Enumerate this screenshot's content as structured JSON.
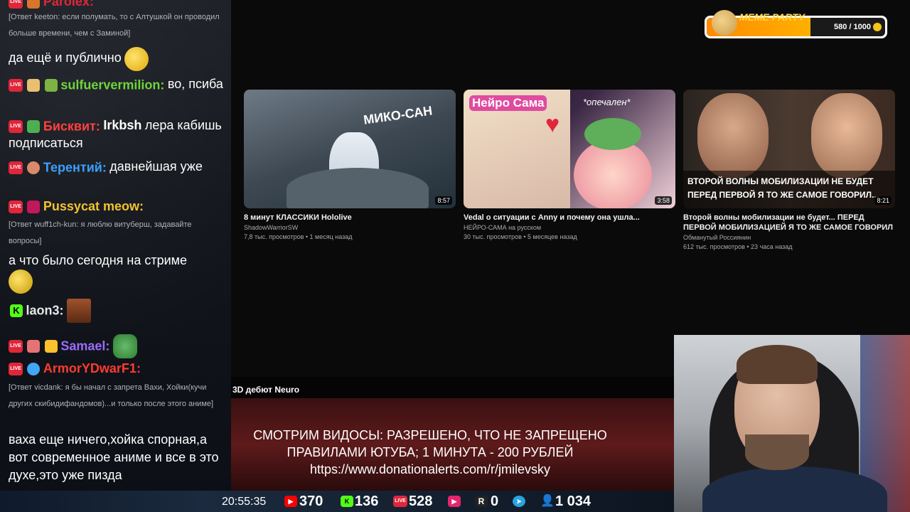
{
  "chat": {
    "messages": [
      {
        "nick": "Parolex:",
        "nick_color": "#e0263a",
        "text": ""
      },
      {
        "reply": "[Ответ keeton: если полумать, то с Алтушкой он проводил больше времени, чем с Заминой]"
      },
      {
        "text": "да ещё и публично"
      },
      {
        "nick": "sulfuervermilion:",
        "nick_color": "#6fd43c",
        "text": "во, псиба"
      },
      {
        "nick": "Бисквит:",
        "nick_color": "#ff4040",
        "bold_lead": "Irkbsh",
        "text": "лера кабишь подписаться"
      },
      {
        "nick": "Терентий:",
        "nick_color": "#3aa0ff",
        "text": "давнейшая уже"
      },
      {
        "nick": "Pussycat meow:",
        "nick_color": "#f2c230",
        "text": ""
      },
      {
        "reply": "[Ответ wuff1ch-kun: я люблю витуберш, задавайте вопросы]"
      },
      {
        "text": "а что было сегодня на стриме"
      },
      {
        "nick": "laon3:",
        "nick_color": "#e6e6e6",
        "text": ""
      },
      {
        "nick": "Samael:",
        "nick_color": "#9b6cff",
        "text": ""
      },
      {
        "nick": "ArmorYDwarF1:",
        "nick_color": "#ff3b2f",
        "text": ""
      },
      {
        "reply": "[Ответ vicdank: я бы начал с запрета Вахи, Хойки(кучи других скибидифандомов)...и только после этого аниме]"
      },
      {
        "text": "ваха еще ничего,хойка спорная,а вот современное аниме и все в это духе,это уже пизда"
      }
    ]
  },
  "meme_party": {
    "title": "MEME PARTY",
    "count": "580 / 1000",
    "progress": 0.58
  },
  "videos": [
    {
      "title": "8 минут КЛАССИКИ Hololive",
      "channel": "ShadowWarriorSW",
      "meta": "7,8 тыс. просмотров • 1 месяц назад",
      "duration": "8:57",
      "thumb_text": "МИКО-САН"
    },
    {
      "title": "Vedal о ситуации с Anny и почему она ушла...",
      "channel": "НЕЙРО-САМА на русском",
      "meta": "30 тыс. просмотров • 5 месяцев назад",
      "duration": "3:58",
      "thumb_text": "Нейро Сама",
      "thumb_text2": "*опечален*"
    },
    {
      "title": "Второй волны мобилизации не будет... ПЕРЕД ПЕРВОЙ МОБИЛИЗАЦИЕЙ Я ТО ЖЕ САМОЕ ГОВОРИЛ",
      "channel": "Обманутый Россиянин",
      "meta": "612 тыс. просмотров • 23 часа назад",
      "duration": "8:21",
      "thumb_text": "ВТОРОЙ ВОЛНЫ МОБИЛИЗАЦИИ НЕ БУДЕТ ПЕРЕД ПЕРВОЙ Я ТО ЖЕ САМОЕ ГОВОРИЛ..."
    }
  ],
  "video_label": "3D дебют Neuro",
  "banner": {
    "line1": "СМОТРИМ ВИДОСЫ: РАЗРЕШЕНО, ЧТО НЕ ЗАПРЕЩЕНО",
    "line2": "ПРАВИЛАМИ ЮТУБА; 1 МИНУТА - 200 РУБЛЕЙ",
    "line3": "https://www.donationalerts.com/r/jmilevsky"
  },
  "stats": {
    "time": "20:55:35",
    "youtube": "370",
    "kick": "136",
    "vkplay": "528",
    "rutube": "",
    "r": "0",
    "telegram": "",
    "viewers": "1 034"
  }
}
